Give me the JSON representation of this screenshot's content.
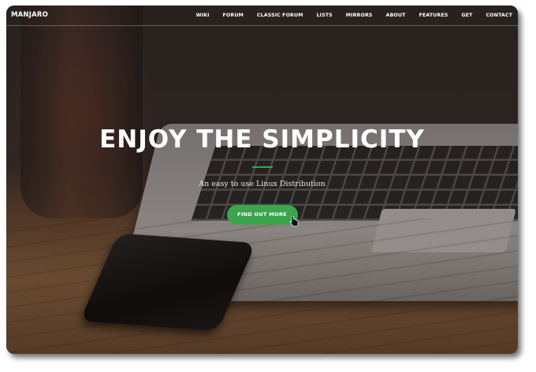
{
  "brand": "MANJARO",
  "nav": {
    "items": [
      "WIKI",
      "FORUM",
      "CLASSIC FORUM",
      "LISTS",
      "MIRRORS",
      "ABOUT",
      "FEATURES",
      "GET",
      "CONTACT"
    ]
  },
  "hero": {
    "title": "ENJOY THE SIMPLICITY",
    "subtitle": "An easy to use Linux Distribution",
    "cta_label": "FIND OUT MORE"
  },
  "colors": {
    "accent": "#35a849",
    "nav_text": "#ffffff"
  },
  "icons": {
    "cursor": "hand-pointer-icon"
  }
}
